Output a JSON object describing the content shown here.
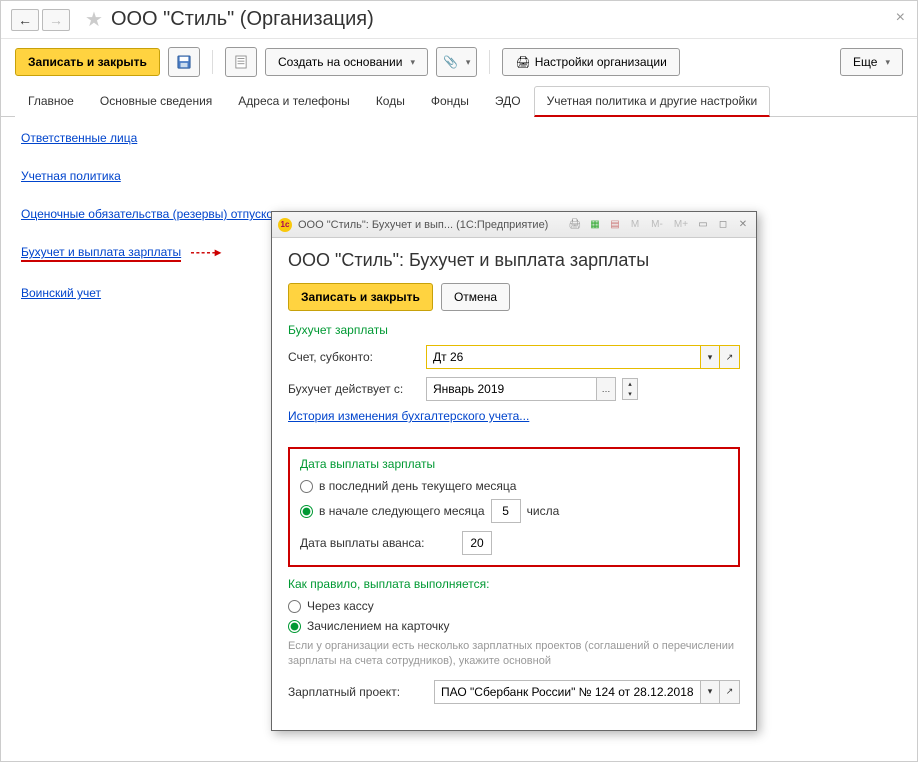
{
  "header": {
    "title": "ООО \"Стиль\" (Организация)"
  },
  "toolbar": {
    "save_close": "Записать и закрыть",
    "create_based": "Создать на основании",
    "org_settings": "Настройки организации",
    "more": "Еще"
  },
  "tabs": [
    "Главное",
    "Основные сведения",
    "Адреса и телефоны",
    "Коды",
    "Фонды",
    "ЭДО",
    "Учетная политика и другие настройки"
  ],
  "links": {
    "responsible": "Ответственные лица",
    "policy": "Учетная политика",
    "reserves": "Оценочные обязательства (резервы) отпусков",
    "payroll": "Бухучет и выплата зарплаты",
    "military": "Воинский учет"
  },
  "dialog": {
    "title_bar": "ООО \"Стиль\": Бухучет и вып...   (1С:Предприятие)",
    "heading": "ООО \"Стиль\": Бухучет и выплата зарплаты",
    "save_close": "Записать и закрыть",
    "cancel": "Отмена",
    "sect_buh": "Бухучет зарплаты",
    "account_label": "Счет, субконто:",
    "account_value": "Дт 26",
    "effective_label": "Бухучет действует с:",
    "effective_value": "Январь 2019",
    "history_link": "История изменения бухгалтерского учета...",
    "sect_paydate": "Дата выплаты зарплаты",
    "radio_last": "в последний день текущего месяца",
    "radio_next": "в начале следующего месяца",
    "day_value": "5",
    "day_suffix": "числа",
    "advance_label": "Дата выплаты аванса:",
    "advance_value": "20",
    "sect_method": "Как правило, выплата выполняется:",
    "radio_cash": "Через кассу",
    "radio_card": "Зачислением на карточку",
    "note": "Если у организации есть несколько зарплатных проектов (соглашений о перечислении зарплаты на счета сотрудников), укажите основной",
    "project_label": "Зарплатный проект:",
    "project_value": "ПАО \"Сбербанк России\" № 124 от 28.12.2018",
    "mlabels": {
      "m": "M",
      "mminus": "M-",
      "mplus": "M+"
    }
  }
}
